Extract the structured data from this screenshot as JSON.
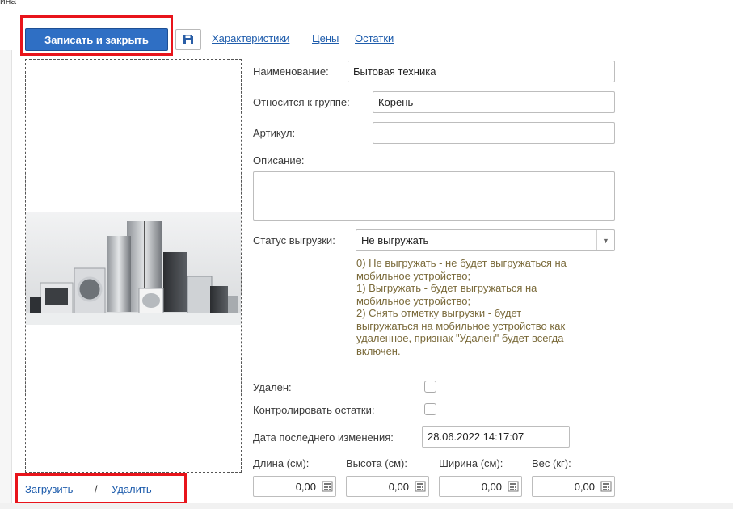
{
  "top_crop_text": "ина",
  "toolbar": {
    "save_close_label": "Записать и закрыть",
    "save_icon": "floppy-disk-icon",
    "links": [
      "Характеристики",
      "Цены",
      "Остатки"
    ]
  },
  "image_panel": {
    "image_subject": "home-appliances-photo",
    "upload_label": "Загрузить",
    "separator": "/",
    "delete_label": "Удалить"
  },
  "form": {
    "name_label": "Наименование:",
    "name_value": "Бытовая техника",
    "group_label": "Относится к группе:",
    "group_value": "Корень",
    "article_label": "Артикул:",
    "article_value": "",
    "description_label": "Описание:",
    "description_value": "",
    "status_label": "Статус выгрузки:",
    "status_value": "Не выгружать",
    "status_help": [
      "0) Не выгружать - не будет выгружаться на",
      "мобильное устройство;",
      "1) Выгружать - будет выгружаться на",
      "мобильное устройство;",
      "2) Снять отметку выгрузки - будет",
      "выгружаться на мобильное устройство как",
      "удаленное, признак \"Удален\" будет всегда",
      "включен."
    ],
    "deleted_label": "Удален:",
    "deleted_checked": false,
    "control_stock_label": "Контролировать остатки:",
    "control_stock_checked": false,
    "last_modified_label": "Дата последнего изменения:",
    "last_modified_value": "28.06.2022 14:17:07",
    "dimensions": [
      {
        "label": "Длина (см):",
        "value": "0,00"
      },
      {
        "label": "Высота (см):",
        "value": "0,00"
      },
      {
        "label": "Ширина (см):",
        "value": "0,00"
      },
      {
        "label": "Вес (кг):",
        "value": "0,00"
      }
    ]
  },
  "colors": {
    "primary_button": "#2f6fc4",
    "link": "#1f5dac",
    "highlight_frame": "#e8141b",
    "help_text": "#7a6a3a"
  }
}
